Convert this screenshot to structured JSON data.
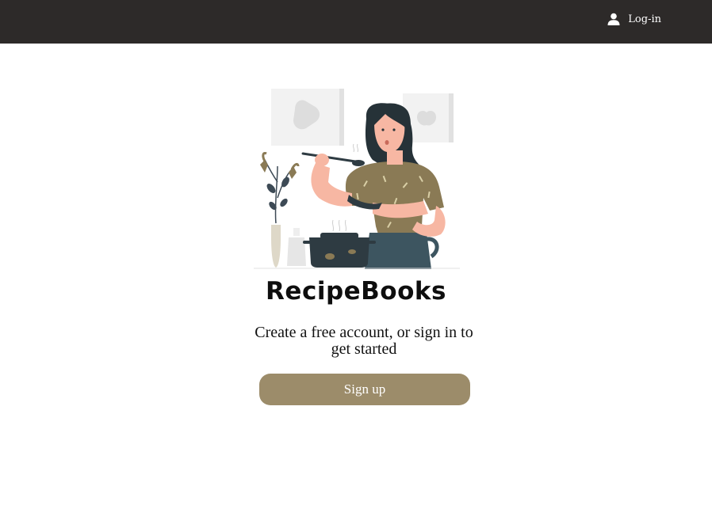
{
  "header": {
    "login_label": "Log-in",
    "background_color": "#2d2a29"
  },
  "hero": {
    "illustration": "woman-cooking-illustration"
  },
  "main": {
    "brand_title": "RecipeBooks",
    "tagline": "Create a free account, or sign in to get started",
    "signup_label": "Sign up",
    "accent_color": "#9c8c6a"
  }
}
